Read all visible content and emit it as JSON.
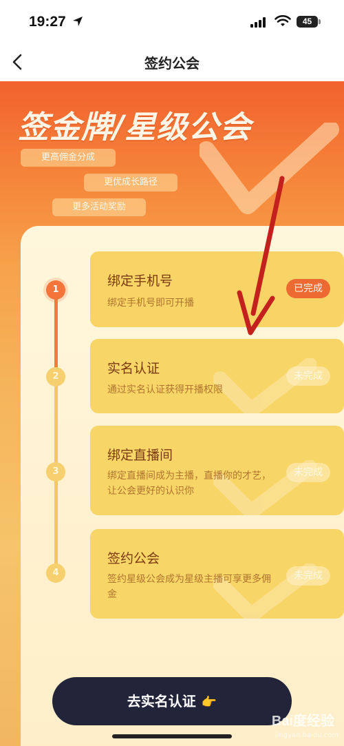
{
  "status_bar": {
    "time": "19:27",
    "battery": "45"
  },
  "nav": {
    "title": "签约公会"
  },
  "hero": {
    "title": "签金牌/星级公会",
    "pills": [
      "更高佣金分成",
      "更优成长路径",
      "更多活动奖励"
    ]
  },
  "steps": [
    {
      "number": "1",
      "title": "绑定手机号",
      "desc": "绑定手机号即可开播",
      "status": "已完成"
    },
    {
      "number": "2",
      "title": "实名认证",
      "desc": "通过实名认证获得开播权限",
      "status": "未完成"
    },
    {
      "number": "3",
      "title": "绑定直播间",
      "desc": "绑定直播间成为主播，直播你的才艺，让公会更好的认识你",
      "status": "未完成"
    },
    {
      "number": "4",
      "title": "签约公会",
      "desc": "签约星级公会成为星级主播可享更多佣金",
      "status": "未完成"
    }
  ],
  "cta": {
    "label": "去实名认证",
    "emoji": "👉"
  },
  "watermark": {
    "text": "Bai度经验",
    "sub": "jingyan.baidu.com"
  },
  "colors": {
    "accent": "#f4743a",
    "cta": "#22243a",
    "step_bg": "#f8d567",
    "arrow": "#c3201e"
  }
}
